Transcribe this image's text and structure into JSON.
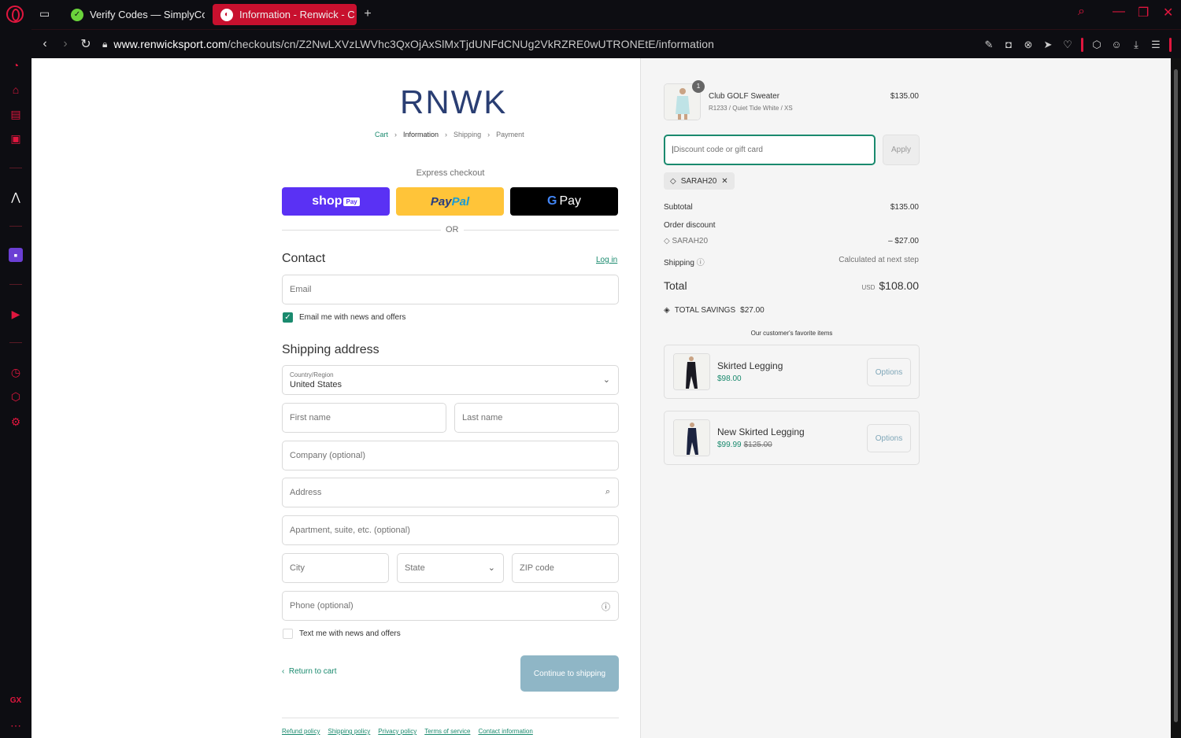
{
  "browser": {
    "tabs": [
      {
        "title": "Verify Codes — SimplyCo"
      },
      {
        "title": "Information - Renwick - C"
      }
    ],
    "url_domain": "www.renwicksport.com",
    "url_path": "/checkouts/cn/Z2NwLXVzLWVhc3QxOjAxSlMxTjdUNFdCNUg2VkRZRE0wUTRONEtE/information",
    "sidebar_label": "GX",
    "accent_color": "#e0163e"
  },
  "checkout": {
    "logo": "RNWK",
    "breadcrumb": [
      "Cart",
      "Information",
      "Shipping",
      "Payment"
    ],
    "express_label": "Express checkout",
    "shop_label": "shop",
    "shop_pay_tag": "Pay",
    "paypal_a": "Pay",
    "paypal_b": "Pal",
    "gpay_label": "Pay",
    "or_label": "OR",
    "contact_heading": "Contact",
    "login_link": "Log in",
    "email_placeholder": "Email",
    "email_optin": "Email me with news and offers",
    "shipping_heading": "Shipping address",
    "country_label": "Country/Region",
    "country_value": "United States",
    "first_name": "First name",
    "last_name": "Last name",
    "company": "Company (optional)",
    "address": "Address",
    "apartment": "Apartment, suite, etc. (optional)",
    "city": "City",
    "state": "State",
    "zip": "ZIP code",
    "phone": "Phone (optional)",
    "sms_optin": "Text me with news and offers",
    "return_link": "Return to cart",
    "continue_button": "Continue to shipping",
    "footer_links": [
      "Refund policy",
      "Shipping policy",
      "Privacy policy",
      "Terms of service",
      "Contact information"
    ],
    "primary_color": "#1a8a6e"
  },
  "summary": {
    "item": {
      "name": "Club GOLF Sweater",
      "variant": "R1233 / Quiet Tide White / XS",
      "price": "$135.00",
      "quantity": "1"
    },
    "discount_placeholder": "Discount code or gift card",
    "apply_button": "Apply",
    "applied_code": "SARAH20",
    "subtotal_label": "Subtotal",
    "subtotal_value": "$135.00",
    "order_discount_label": "Order discount",
    "discount_code": "SARAH20",
    "discount_value": "– $27.00",
    "shipping_label": "Shipping",
    "shipping_value": "Calculated at next step",
    "total_label": "Total",
    "total_currency": "USD",
    "total_value": "$108.00",
    "savings_label": "TOTAL SAVINGS",
    "savings_value": "$27.00",
    "favorites_title": "Our customer's favorite items",
    "favorites": [
      {
        "name": "Skirted Legging",
        "price": "$98.00",
        "old_price": "",
        "button": "Options"
      },
      {
        "name": "New Skirted Legging",
        "price": "$99.99",
        "old_price": "$125.00",
        "button": "Options"
      }
    ]
  }
}
